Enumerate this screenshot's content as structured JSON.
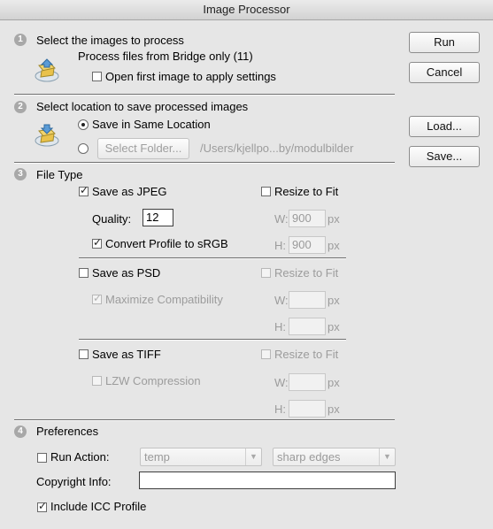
{
  "window": {
    "title": "Image Processor"
  },
  "buttons": {
    "run": "Run",
    "cancel": "Cancel",
    "load": "Load...",
    "save": "Save..."
  },
  "step1": {
    "number": "1",
    "title": "Select the images to process",
    "source": "Process files from Bridge only (11)",
    "open_first_label": "Open first image to apply settings",
    "open_first_checked": false
  },
  "step2": {
    "number": "2",
    "title": "Select location to save processed images",
    "same_location_label": "Save in Same Location",
    "same_location_selected": true,
    "select_folder_label": "Select Folder...",
    "folder_path": "/Users/kjellpo...by/modulbilder"
  },
  "step3": {
    "number": "3",
    "title": "File Type",
    "jpeg": {
      "label": "Save as JPEG",
      "checked": true,
      "quality_label": "Quality:",
      "quality_value": "12",
      "convert_label": "Convert Profile to sRGB",
      "convert_checked": true,
      "resize_label": "Resize to Fit",
      "resize_checked": false,
      "w_label": "W:",
      "w_value": "900",
      "h_label": "H:",
      "h_value": "900",
      "unit": "px"
    },
    "psd": {
      "label": "Save as PSD",
      "checked": false,
      "maximize_label": "Maximize Compatibility",
      "maximize_checked": true,
      "resize_label": "Resize to Fit",
      "w_label": "W:",
      "h_label": "H:",
      "unit": "px"
    },
    "tiff": {
      "label": "Save as TIFF",
      "checked": false,
      "lzw_label": "LZW Compression",
      "lzw_checked": false,
      "resize_label": "Resize to Fit",
      "w_label": "W:",
      "h_label": "H:",
      "unit": "px"
    }
  },
  "step4": {
    "number": "4",
    "title": "Preferences",
    "run_action_label": "Run Action:",
    "run_action_checked": false,
    "action_set": "temp",
    "action": "sharp edges",
    "copyright_label": "Copyright Info:",
    "copyright_value": "",
    "icc_label": "Include ICC Profile",
    "icc_checked": true
  },
  "icons": {
    "bridge": "bridge-folder-icon",
    "save_location": "folder-arrow-icon",
    "check": "checkmark-icon"
  }
}
